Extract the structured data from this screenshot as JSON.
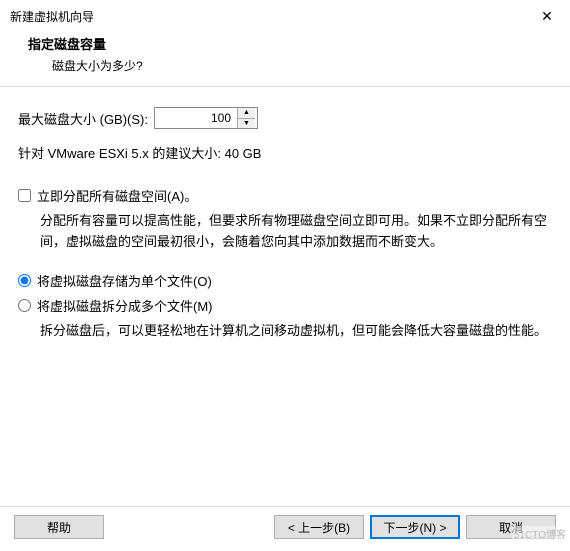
{
  "titlebar": {
    "title": "新建虚拟机向导",
    "close_glyph": "✕"
  },
  "header": {
    "heading": "指定磁盘容量",
    "sub": "磁盘大小为多少?"
  },
  "size": {
    "label": "最大磁盘大小 (GB)(S):",
    "value": "100",
    "up_glyph": "▲",
    "down_glyph": "▼"
  },
  "recommend": "针对 VMware ESXi 5.x 的建议大小: 40 GB",
  "allocate": {
    "checked": false,
    "label": "立即分配所有磁盘空间(A)。",
    "desc": "分配所有容量可以提高性能，但要求所有物理磁盘空间立即可用。如果不立即分配所有空间，虚拟磁盘的空间最初很小，会随着您向其中添加数据而不断变大。"
  },
  "store": {
    "single_label": "将虚拟磁盘存储为单个文件(O)",
    "split_label": "将虚拟磁盘拆分成多个文件(M)",
    "split_desc": "拆分磁盘后，可以更轻松地在计算机之间移动虚拟机，但可能会降低大容量磁盘的性能。",
    "selected": "single"
  },
  "footer": {
    "help": "帮助",
    "back": "< 上一步(B)",
    "next": "下一步(N) >",
    "cancel": "取消"
  },
  "watermark": "51CTO博客"
}
